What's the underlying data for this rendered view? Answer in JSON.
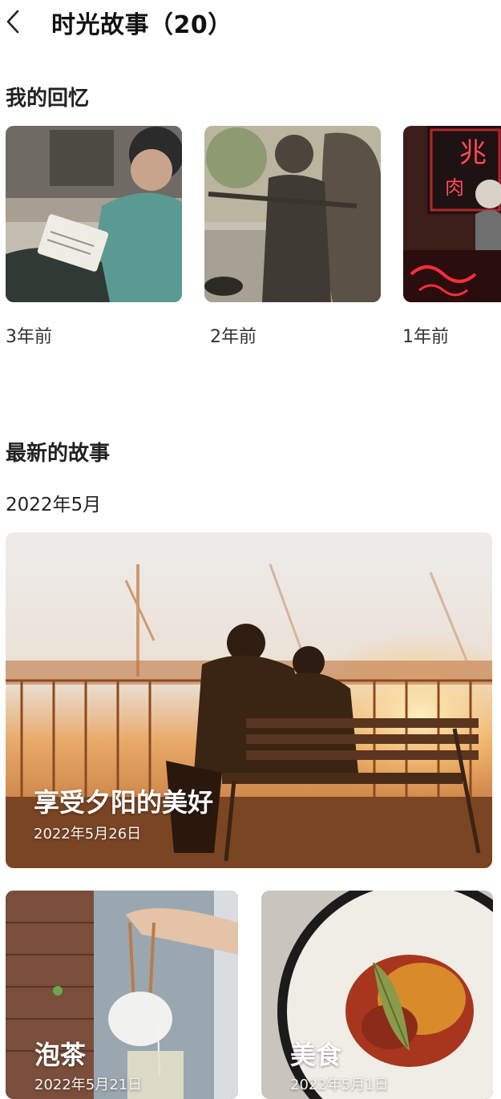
{
  "header": {
    "title": "时光故事（20）",
    "back_icon": "chevron-left-icon"
  },
  "memories": {
    "title": "我的回忆",
    "items": [
      {
        "label": "3年前"
      },
      {
        "label": "2年前"
      },
      {
        "label": "1年前"
      }
    ]
  },
  "latest": {
    "title": "最新的故事",
    "month": "2022年5月",
    "featured": {
      "title": "享受夕阳的美好",
      "date": "2022年5月26日"
    },
    "stories": [
      {
        "title": "泡茶",
        "date": "2022年5月21日"
      },
      {
        "title": "美食",
        "date": "2022年5月1日"
      }
    ]
  }
}
